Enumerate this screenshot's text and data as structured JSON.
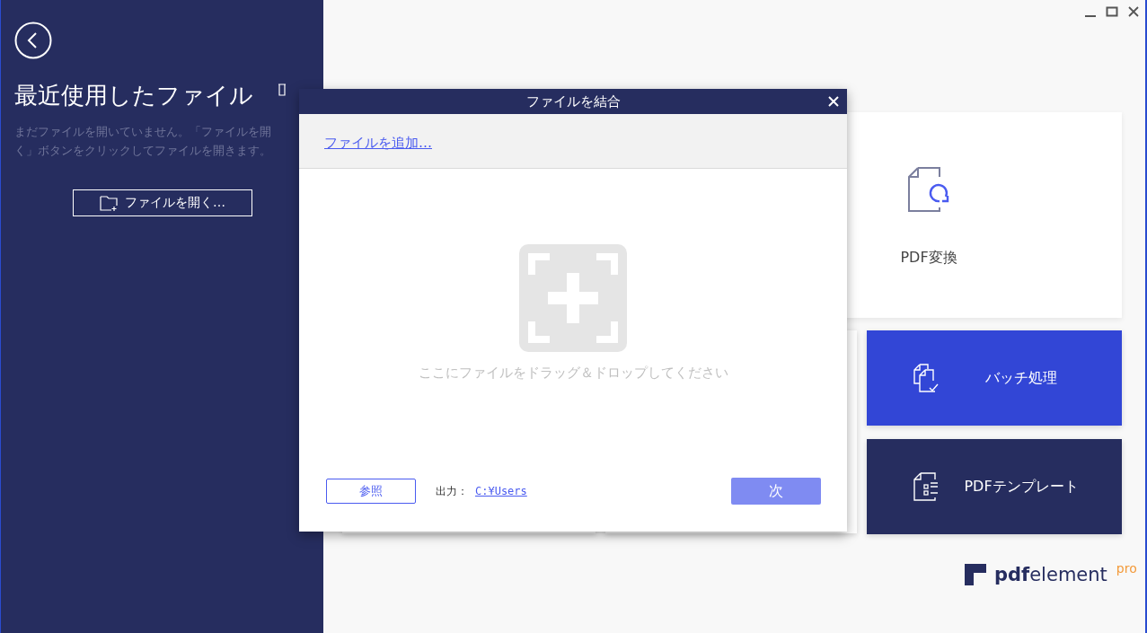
{
  "sidebar": {
    "title": "最近使用したファイル",
    "message": "まだファイルを開いていません。「ファイルを開く」ボタンをクリックしてファイルを開きます。",
    "open_button": "ファイルを開く…"
  },
  "tiles": [
    {
      "label": "PDF変換",
      "kind": "convert"
    },
    {
      "label": "バッチ処理",
      "kind": "batch"
    },
    {
      "label": "PDFテンプレート",
      "kind": "template"
    }
  ],
  "dialog": {
    "title": "ファイルを結合",
    "add_link": "ファイルを追加…",
    "drop_hint": "ここにファイルをドラッグ＆ドロップしてください",
    "browse_button": "参照",
    "output_label": "出力：",
    "output_path": "C:¥Users",
    "next_button": {
      "label": "次",
      "disabled": true
    }
  },
  "brand": {
    "name": "**pdf**element",
    "edition": "pro"
  }
}
